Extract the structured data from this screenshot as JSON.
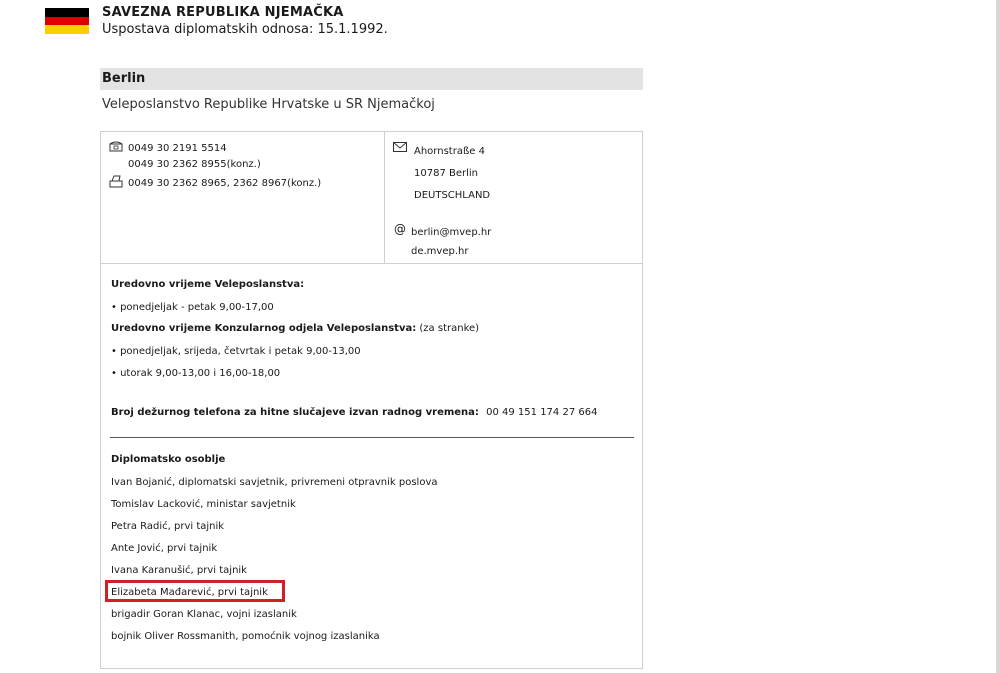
{
  "header": {
    "country": "SAVEZNA REPUBLIKA NJEMAČKA",
    "established": "Uspostava diplomatskih odnosa: 15.1.1992.",
    "flag_colors": [
      "#000000",
      "#dd0000",
      "#ffce00"
    ],
    "flag_icon": "germany-flag-icon"
  },
  "mission": {
    "city": "Berlin",
    "name": "Veleposlanstvo Republike Hrvatske u SR Njemačkoj"
  },
  "contact": {
    "phone_icon": "phone-icon",
    "phones": [
      "0049 30 2191 5514",
      "0049 30 2362 8955(konz.)"
    ],
    "fax_icon": "fax-icon",
    "fax": "0049 30 2362 8965, 2362 8967(konz.)",
    "address_icon": "envelope-icon",
    "address_lines": [
      "Ahornstraße 4",
      "10787 Berlin",
      "DEUTSCHLAND"
    ],
    "web_icon": "at-icon",
    "email": "berlin@mvep.hr",
    "website": "de.mvep.hr"
  },
  "hours": {
    "embassy_title": "Uredovno vrijeme Veleposlanstva:",
    "embassy_items": [
      "• ponedjeljak - petak 9,00-17,00"
    ],
    "consular_title": "Uredovno vrijeme Konzularnog odjela Veleposlanstva:",
    "consular_note": "(za stranke)",
    "consular_items": [
      "• ponedjeljak, srijeda, četvrtak i petak 9,00-13,00",
      "• utorak 9,00-13,00 i 16,00-18,00"
    ]
  },
  "emergency": {
    "label": "Broj dežurnog telefona za hitne slučajeve izvan radnog vremena:",
    "number": "00 49 151 174 27 664"
  },
  "staff": {
    "title": "Diplomatsko osoblje",
    "members": [
      "Ivan Bojanić, diplomatski savjetnik, privremeni otpravnik poslova",
      "Tomislav Lacković, ministar savjetnik",
      "Petra Radić, prvi tajnik",
      "Ante Jović, prvi tajnik",
      "Ivana Karanušić, prvi tajnik",
      "Elizabeta Mađarević, prvi tajnik",
      "brigadir Goran Klanac, vojni izaslanik",
      "bojnik Oliver Rossmanith, pomoćnik vojnog izaslanika"
    ],
    "highlight_index": 5,
    "highlight_color": "#d01f25"
  }
}
